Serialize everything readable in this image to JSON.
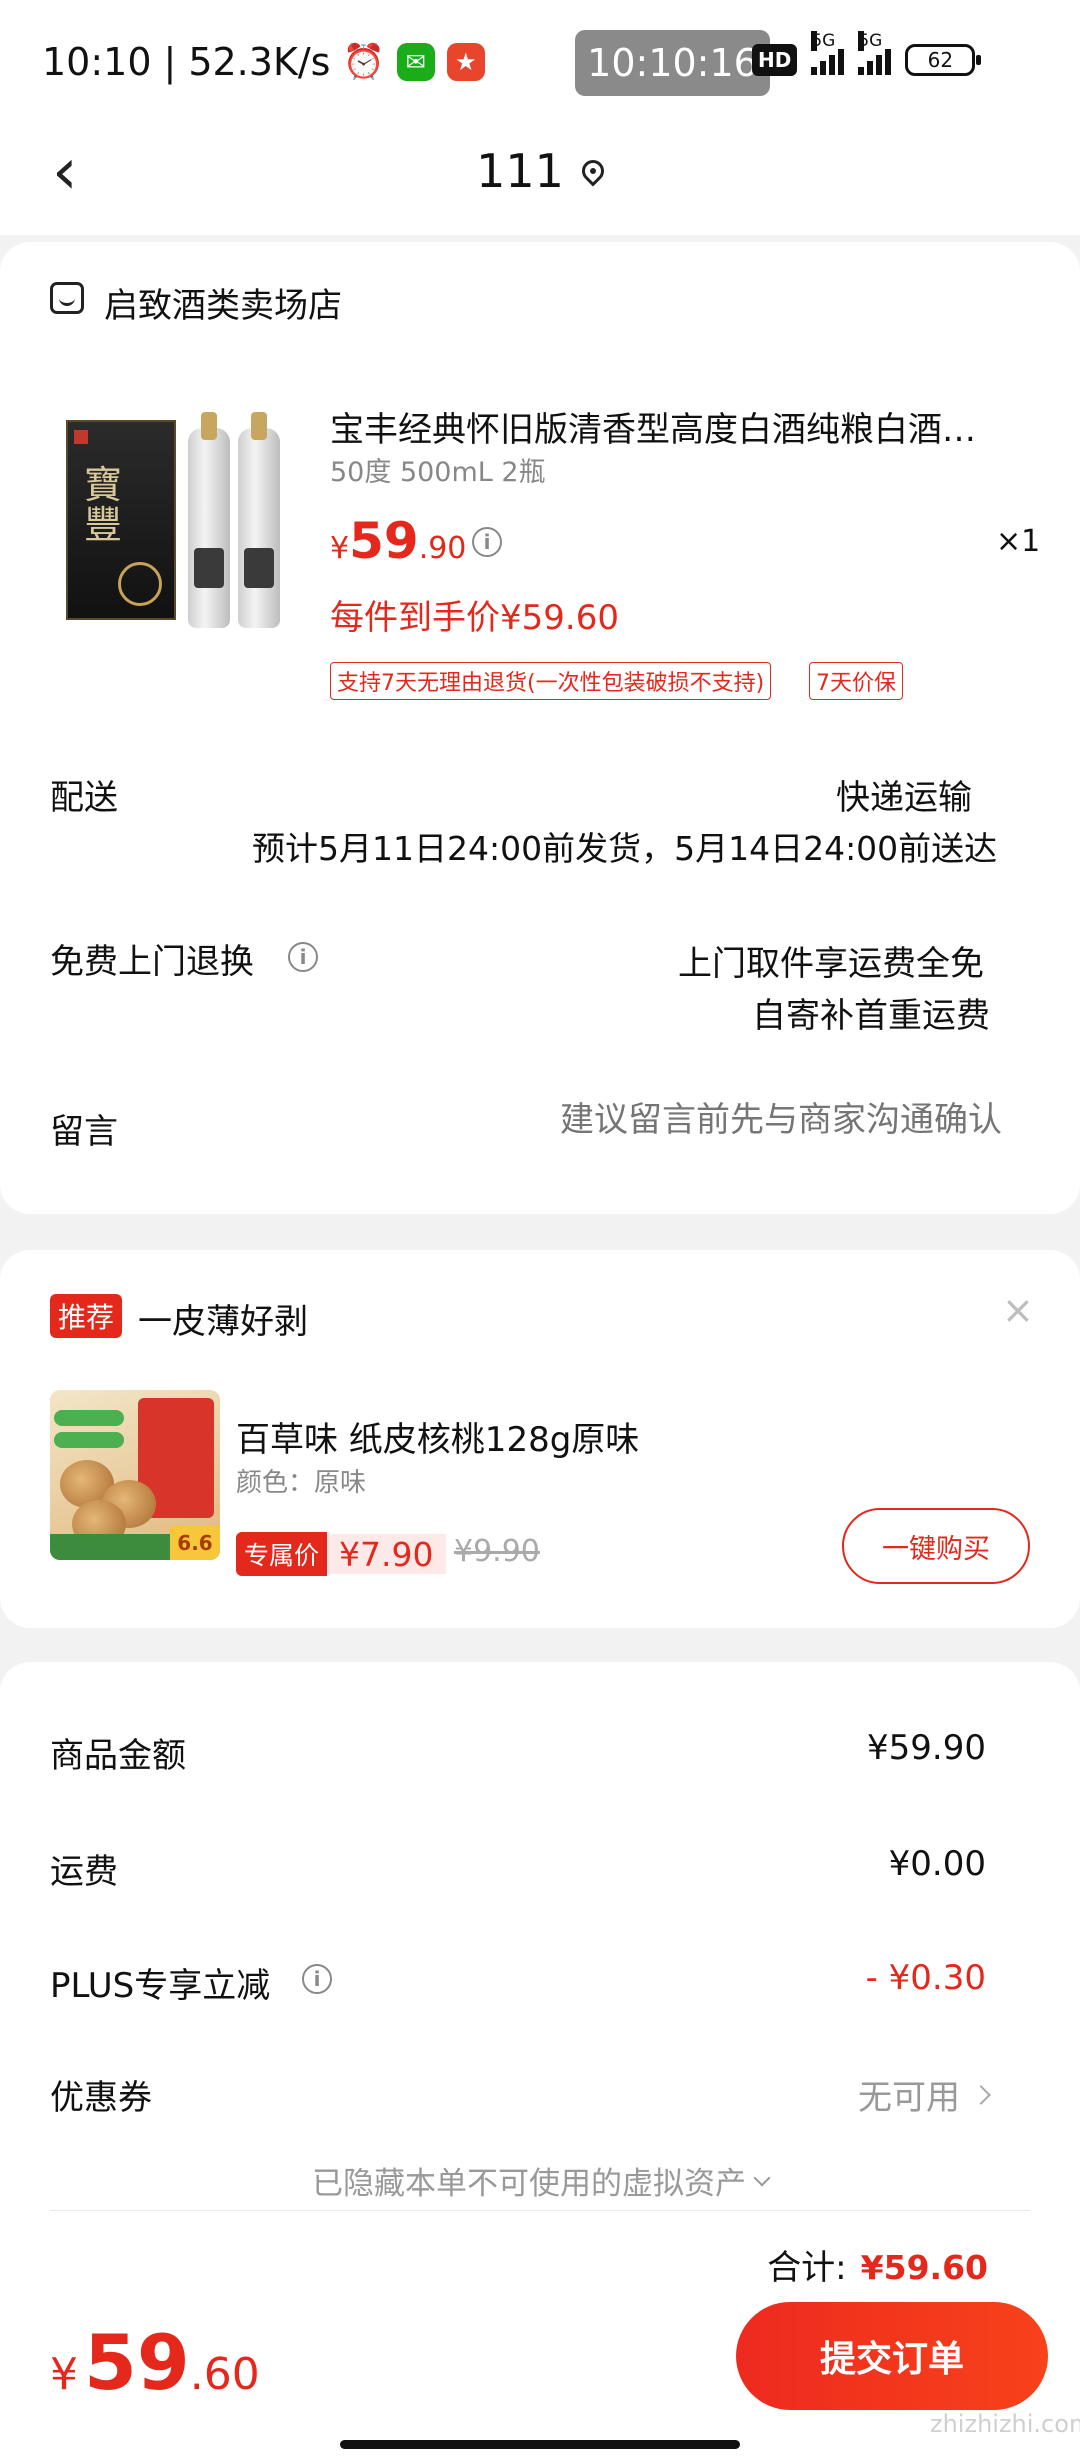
{
  "status_bar": {
    "time": "10:10",
    "speed": "52.3K/s",
    "clock": "10:10:16",
    "hd": "HD",
    "net1": "5G",
    "net2": "5G",
    "battery": "62"
  },
  "nav": {
    "title": "111"
  },
  "store": {
    "name": "启致酒类卖场店"
  },
  "product": {
    "title": "宝丰经典怀旧版清香型高度白酒纯粮白酒…",
    "spec": "50度 500mL 2瓶",
    "price_currency": "¥",
    "price_int": "59",
    "price_dec": ".90",
    "qty": "×1",
    "unit_price": "每件到手价¥59.60",
    "tags": [
      "支持7天无理由退货(一次性包装破损不支持)",
      "7天价保"
    ]
  },
  "shipping": {
    "label": "配送",
    "method": "快递运输",
    "estimate": "预计5月11日24:00前发货，5月14日24:00前送达"
  },
  "returns": {
    "label": "免费上门退换",
    "line1": "上门取件享运费全免",
    "line2": "自寄补首重运费"
  },
  "message": {
    "label": "留言",
    "placeholder": "建议留言前先与商家沟通确认"
  },
  "recommend": {
    "badge": "推荐",
    "title": "一皮薄好剥",
    "close": "×",
    "item_name": "百草味 纸皮核桃128g原味",
    "item_spec": "颜色：原味",
    "exclusive_label": "专属价",
    "price": "¥7.90",
    "old_price": "¥9.90",
    "buy_label": "一键购买"
  },
  "summary": {
    "goods_label": "商品金额",
    "goods_value": "¥59.90",
    "freight_label": "运费",
    "freight_value": "¥0.00",
    "plus_label": "PLUS专享立减",
    "plus_value": "- ¥0.30",
    "coupon_label": "优惠券",
    "coupon_value": "无可用",
    "hidden_note": "已隐藏本单不可使用的虚拟资产",
    "total_label": "合计:",
    "total_value": "¥59.60"
  },
  "footer": {
    "currency": "¥",
    "price_int": "59",
    "price_dec": ".60",
    "submit_label": "提交订单",
    "watermark": "zhizhizhi.com"
  },
  "colors": {
    "accent": "#e4281c",
    "background": "#f2f2f2"
  }
}
